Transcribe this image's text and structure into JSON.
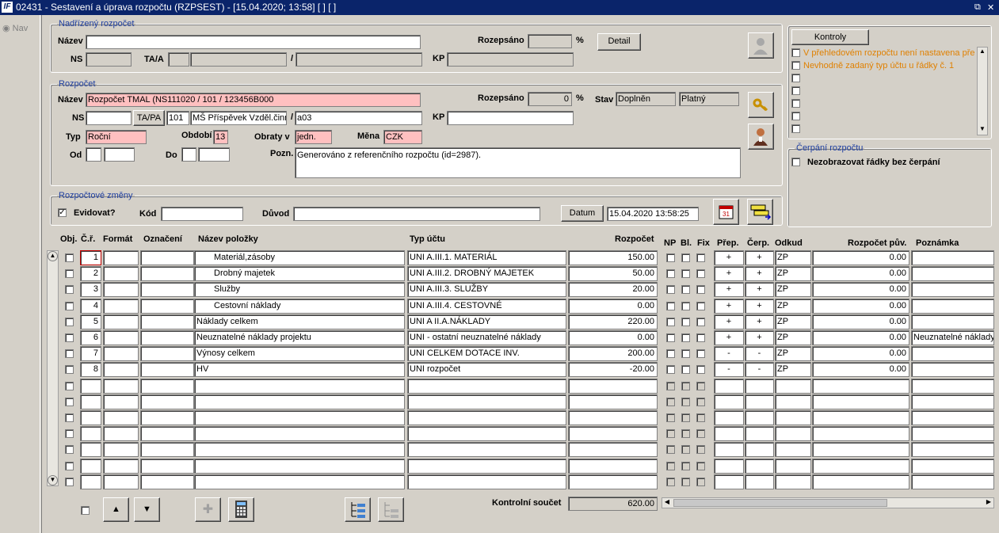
{
  "window": {
    "logo": "IF",
    "title": "02431 - Sestavení a úprava rozpočtu (RZPSEST) - [15.04.2020; 13:58]  [ ]  [ ]",
    "controls": "⧉ ✕"
  },
  "nav": {
    "label": "Nav"
  },
  "parent": {
    "legend": "Nadřízený rozpočet",
    "name_label": "Název",
    "name_value": "",
    "rozepsano_label": "Rozepsáno",
    "rozepsano_value": "",
    "percent": "%",
    "detail_button": "Detail",
    "ns_label": "NS",
    "taa_label": "TA/A",
    "slash": "/",
    "kp_label": "KP"
  },
  "budget": {
    "legend": "Rozpočet",
    "name_label": "Název",
    "name_value": "Rozpočet TMAL (NS111020 / 101 / 123456B000",
    "rozepsano_label": "Rozepsáno",
    "rozepsano_value": "0",
    "percent": "%",
    "stav_label": "Stav",
    "stav_value": "Doplněn",
    "stav2_value": "Platný",
    "ns_label": "NS",
    "tapa_button": "TA/PA",
    "tapa_code": "101",
    "tapa_name": "MŠ Příspěvek Vzděl.činn",
    "slash": "/",
    "a_value": "a03",
    "kp_label": "KP",
    "typ_label": "Typ",
    "typ_value": "Roční",
    "obdobi_label": "Období",
    "obdobi_value": "13",
    "obraty_label": "Obraty v",
    "obraty_value": "jedn.",
    "mena_label": "Měna",
    "mena_value": "CZK",
    "od_label": "Od",
    "do_label": "Do",
    "pozn_label": "Pozn.",
    "pozn_value": "Generováno z referenčního rozpočtu (id=2987)."
  },
  "changes": {
    "legend": "Rozpočtové změny",
    "evidovat_label": "Evidovat?",
    "evidovat_checked": true,
    "kod_label": "Kód",
    "duvod_label": "Důvod",
    "datum_button": "Datum",
    "datum_value": "15.04.2020 13:58:25"
  },
  "controls_panel": {
    "button": "Kontroly",
    "messages": [
      "V přehledovém rozpočtu není nastavena pře",
      "Nevhodně zadaný typ účtu u řádky č. 1"
    ]
  },
  "cerpani": {
    "legend": "Čerpání rozpočtu",
    "label": "Nezobrazovat řádky bez čerpání"
  },
  "table": {
    "headers": {
      "obj": "Obj.",
      "cr": "Č.ř.",
      "format": "Formát",
      "oznaceni": "Označení",
      "nazev": "Název položky",
      "typ": "Typ účtu",
      "rozpocet": "Rozpočet",
      "np": "NP",
      "bl": "Bl.",
      "fix": "Fix",
      "prep": "Přep.",
      "cerp": "Čerp.",
      "odkud": "Odkud",
      "puv": "Rozpočet pův.",
      "pozn": "Poznámka"
    },
    "rows": [
      {
        "cr": "1",
        "nazev": "Materiál,zásoby",
        "indent": true,
        "typ": "UNI A.III.1. MATERIÁL",
        "rozpocet": "150.00",
        "prep": "+",
        "cerp": "+",
        "odkud": "ZP",
        "puv": "0.00",
        "pozn": "",
        "selected": true
      },
      {
        "cr": "2",
        "nazev": "Drobný majetek",
        "indent": true,
        "typ": "UNI A.III.2. DROBNÝ MAJETEK",
        "rozpocet": "50.00",
        "prep": "+",
        "cerp": "+",
        "odkud": "ZP",
        "puv": "0.00",
        "pozn": ""
      },
      {
        "cr": "3",
        "nazev": "Služby",
        "indent": true,
        "typ": "UNI A.III.3. SLUŽBY",
        "rozpocet": "20.00",
        "prep": "+",
        "cerp": "+",
        "odkud": "ZP",
        "puv": "0.00",
        "pozn": ""
      },
      {
        "cr": "4",
        "nazev": "Cestovní náklady",
        "indent": true,
        "typ": "UNI A.III.4. CESTOVNÉ",
        "rozpocet": "0.00",
        "prep": "+",
        "cerp": "+",
        "odkud": "ZP",
        "puv": "0.00",
        "pozn": ""
      },
      {
        "cr": "5",
        "nazev": "Náklady celkem",
        "indent": false,
        "typ": "UNI A II.A.NÁKLADY",
        "rozpocet": "220.00",
        "prep": "+",
        "cerp": "+",
        "odkud": "ZP",
        "puv": "0.00",
        "pozn": ""
      },
      {
        "cr": "6",
        "nazev": "Neuznatelné náklady projektu",
        "indent": false,
        "typ": "UNI - ostatní neuznatelné náklady",
        "rozpocet": "0.00",
        "prep": "+",
        "cerp": "+",
        "odkud": "ZP",
        "puv": "0.00",
        "pozn": "Neuznatelné náklady"
      },
      {
        "cr": "7",
        "nazev": "Výnosy celkem",
        "indent": false,
        "typ": "UNI CELKEM DOTACE INV.",
        "rozpocet": "200.00",
        "prep": "-",
        "cerp": "-",
        "odkud": "ZP",
        "puv": "0.00",
        "pozn": ""
      },
      {
        "cr": "8",
        "nazev": "HV",
        "indent": false,
        "typ": "UNI rozpočet",
        "rozpocet": "-20.00",
        "prep": "-",
        "cerp": "-",
        "odkud": "ZP",
        "puv": "0.00",
        "pozn": ""
      }
    ],
    "empty_rows": 7
  },
  "footer": {
    "kontrolni_label": "Kontrolní součet",
    "kontrolni_value": "620.00"
  },
  "colors": {
    "pink": "#ffc0c0",
    "selected": "#c6e0f8",
    "legend": "#1f3fa0",
    "warning": "#e08000",
    "titlebar": "#0a246a"
  }
}
